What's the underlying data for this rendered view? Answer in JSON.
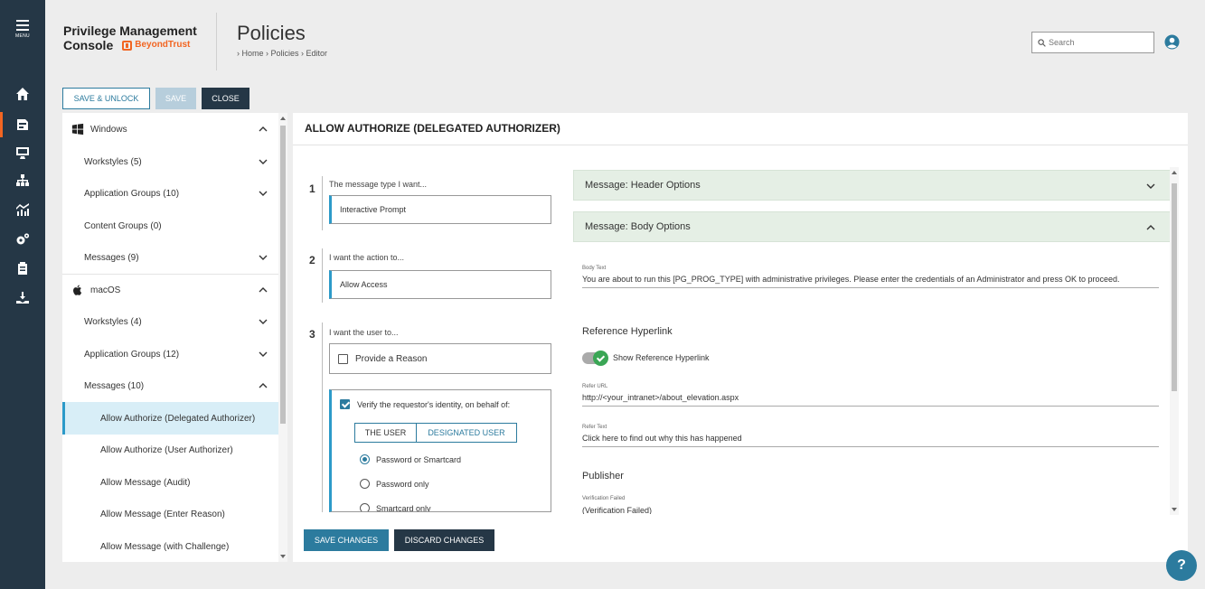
{
  "rail": {
    "menu_label": "MENU",
    "icons": [
      "home-icon",
      "policy-icon",
      "computer-icon",
      "org-icon",
      "analytics-icon",
      "settings-icon",
      "clipboard-icon",
      "deploy-icon"
    ]
  },
  "header": {
    "brand_line1": "Privilege Management",
    "brand_line2": "Console",
    "brand_vendor": "BeyondTrust",
    "page_title": "Policies",
    "breadcrumb": "› Home › Policies › Editor",
    "search_placeholder": "Search"
  },
  "toolbar": {
    "save_unlock": "SAVE & UNLOCK",
    "save": "SAVE",
    "close": "CLOSE"
  },
  "tree": {
    "items": [
      {
        "label": "Windows",
        "kind": "os",
        "chevron": "up"
      },
      {
        "label": "Workstyles (5)",
        "kind": "group",
        "chevron": "down"
      },
      {
        "label": "Application Groups (10)",
        "kind": "group",
        "chevron": "down"
      },
      {
        "label": "Content Groups (0)",
        "kind": "group",
        "chevron": ""
      },
      {
        "label": "Messages (9)",
        "kind": "group",
        "chevron": "down"
      },
      {
        "label": "macOS",
        "kind": "os",
        "chevron": "up"
      },
      {
        "label": "Workstyles (4)",
        "kind": "group",
        "chevron": "down"
      },
      {
        "label": "Application Groups (12)",
        "kind": "group",
        "chevron": "down"
      },
      {
        "label": "Messages (10)",
        "kind": "group",
        "chevron": "up"
      },
      {
        "label": "Allow Authorize (Delegated Authorizer)",
        "kind": "leaf",
        "chevron": "",
        "selected": true
      },
      {
        "label": "Allow Authorize (User Authorizer)",
        "kind": "leaf",
        "chevron": ""
      },
      {
        "label": "Allow Message (Audit)",
        "kind": "leaf",
        "chevron": ""
      },
      {
        "label": "Allow Message (Enter Reason)",
        "kind": "leaf",
        "chevron": ""
      },
      {
        "label": "Allow Message (with Challenge)",
        "kind": "leaf",
        "chevron": ""
      }
    ]
  },
  "editor": {
    "title": "ALLOW AUTHORIZE (DELEGATED AUTHORIZER)",
    "step1": {
      "num": "1",
      "label": "The message type I want...",
      "value": "Interactive Prompt"
    },
    "step2": {
      "num": "2",
      "label": "I want the action to...",
      "value": "Allow Access"
    },
    "step3": {
      "num": "3",
      "label": "I want the user to...",
      "reason_label": "Provide a Reason",
      "reason_checked": false,
      "verify_label": "Verify the requestor's identity, on behalf of:",
      "verify_checked": true,
      "seg_user": "THE USER",
      "seg_designated": "DESIGNATED USER",
      "radios": [
        {
          "label": "Password or Smartcard",
          "selected": true
        },
        {
          "label": "Password only",
          "selected": false
        },
        {
          "label": "Smartcard only",
          "selected": false
        }
      ]
    },
    "save_changes": "SAVE CHANGES",
    "discard_changes": "DISCARD CHANGES"
  },
  "options": {
    "header_options": "Message: Header Options",
    "body_options": "Message: Body Options",
    "body_text_label": "Body Text",
    "body_text_value": "You are about to run this [PG_PROG_TYPE] with administrative privileges. Please enter the credentials of an Administrator and press OK to proceed.",
    "ref_hyperlink_title": "Reference Hyperlink",
    "show_ref_hyperlink": "Show Reference Hyperlink",
    "refer_url_label": "Refer URL",
    "refer_url_value": "http://<your_intranet>/about_elevation.aspx",
    "refer_text_label": "Refer Text",
    "refer_text_value": "Click here to find out why this has happened",
    "publisher_title": "Publisher",
    "verification_failed_label": "Verification Failed",
    "verification_failed_value": "(Verification Failed)"
  },
  "help_label": "?",
  "colors": {
    "rail_bg": "#253746",
    "accent_blue": "#2c7b9e",
    "brand_orange": "#f26522",
    "accordion_bg": "#e5efe5",
    "toggle_green": "#3aa655"
  }
}
